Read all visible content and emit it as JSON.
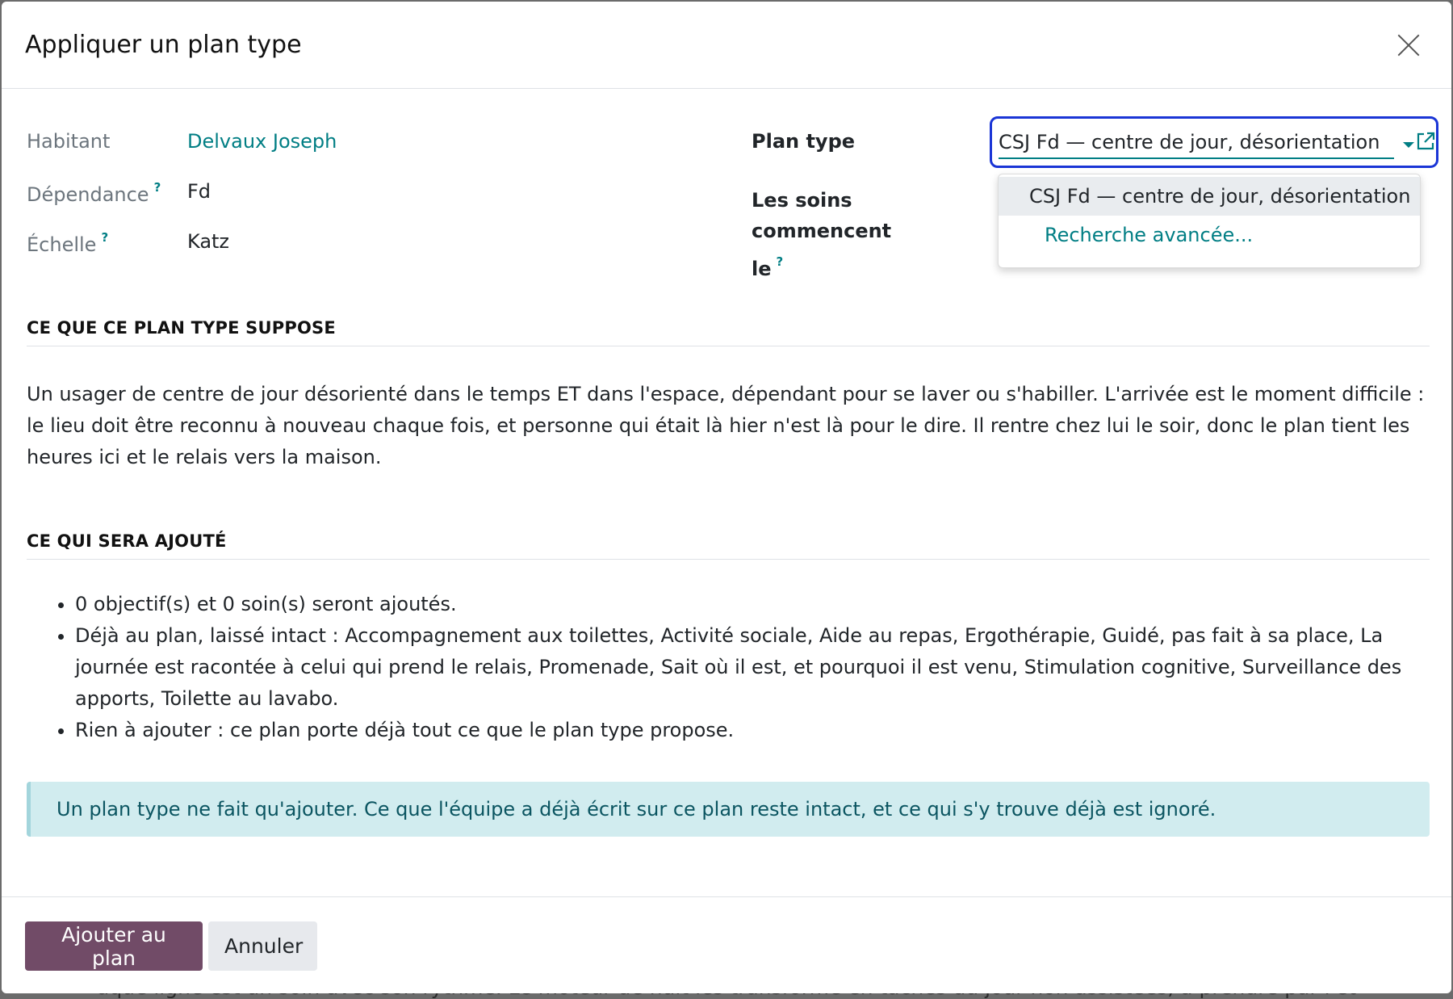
{
  "backdrop": {
    "text": "aque ligne est un soin avec son rythme. Le moteur de nuit les transforme en tâches du jour        non assistées, à prendre par l'équipe."
  },
  "dialog": {
    "title": "Appliquer un plan type",
    "fields": {
      "habitant_label": "Habitant",
      "habitant_value": "Delvaux Joseph",
      "dependance_label": "Dépendance",
      "dependance_value": "Fd",
      "echelle_label": "Échelle",
      "echelle_value": "Katz",
      "help_mark": "?",
      "plan_type_label": "Plan type",
      "plan_type_value": "CSJ Fd — centre de jour, désorientation",
      "start_label_line1": "Les soins commencent",
      "start_label_line2": "le"
    },
    "dropdown": {
      "options": [
        "CSJ Fd — centre de jour, désorientation",
        "Recherche avancée..."
      ]
    },
    "section_assumes": {
      "title": "CE QUE CE PLAN TYPE SUPPOSE",
      "text": "Un usager de centre de jour désorienté dans le temps ET dans l'espace, dépendant pour se laver ou s'habiller. L'arrivée est le moment difficile : le lieu doit être reconnu à nouveau chaque fois, et personne qui était là hier n'est là pour le dire. Il rentre chez lui le soir, donc le plan tient les heures ici et le relais vers la maison."
    },
    "section_added": {
      "title": "CE QUI SERA AJOUTÉ",
      "items": [
        "0 objectif(s) et 0 soin(s) seront ajoutés.",
        "Déjà au plan, laissé intact : Accompagnement aux toilettes, Activité sociale, Aide au repas, Ergothérapie, Guidé, pas fait à sa place, La journée est racontée à celui qui prend le relais, Promenade, Sait où il est, et pourquoi il est venu, Stimulation cognitive, Surveillance des apports, Toilette au lavabo.",
        "Rien à ajouter : ce plan porte déjà tout ce que le plan type propose."
      ]
    },
    "alert": "Un plan type ne fait qu'ajouter. Ce que l'équipe a déjà écrit sur ce plan reste intact, et ce qui s'y trouve déjà est ignoré.",
    "buttons": {
      "primary": "Ajouter au plan",
      "secondary": "Annuler"
    }
  },
  "colors": {
    "accent": "#017e84",
    "primary_button": "#714b67",
    "focus_ring": "#1a35d6",
    "alert_bg": "#d1ecef"
  }
}
